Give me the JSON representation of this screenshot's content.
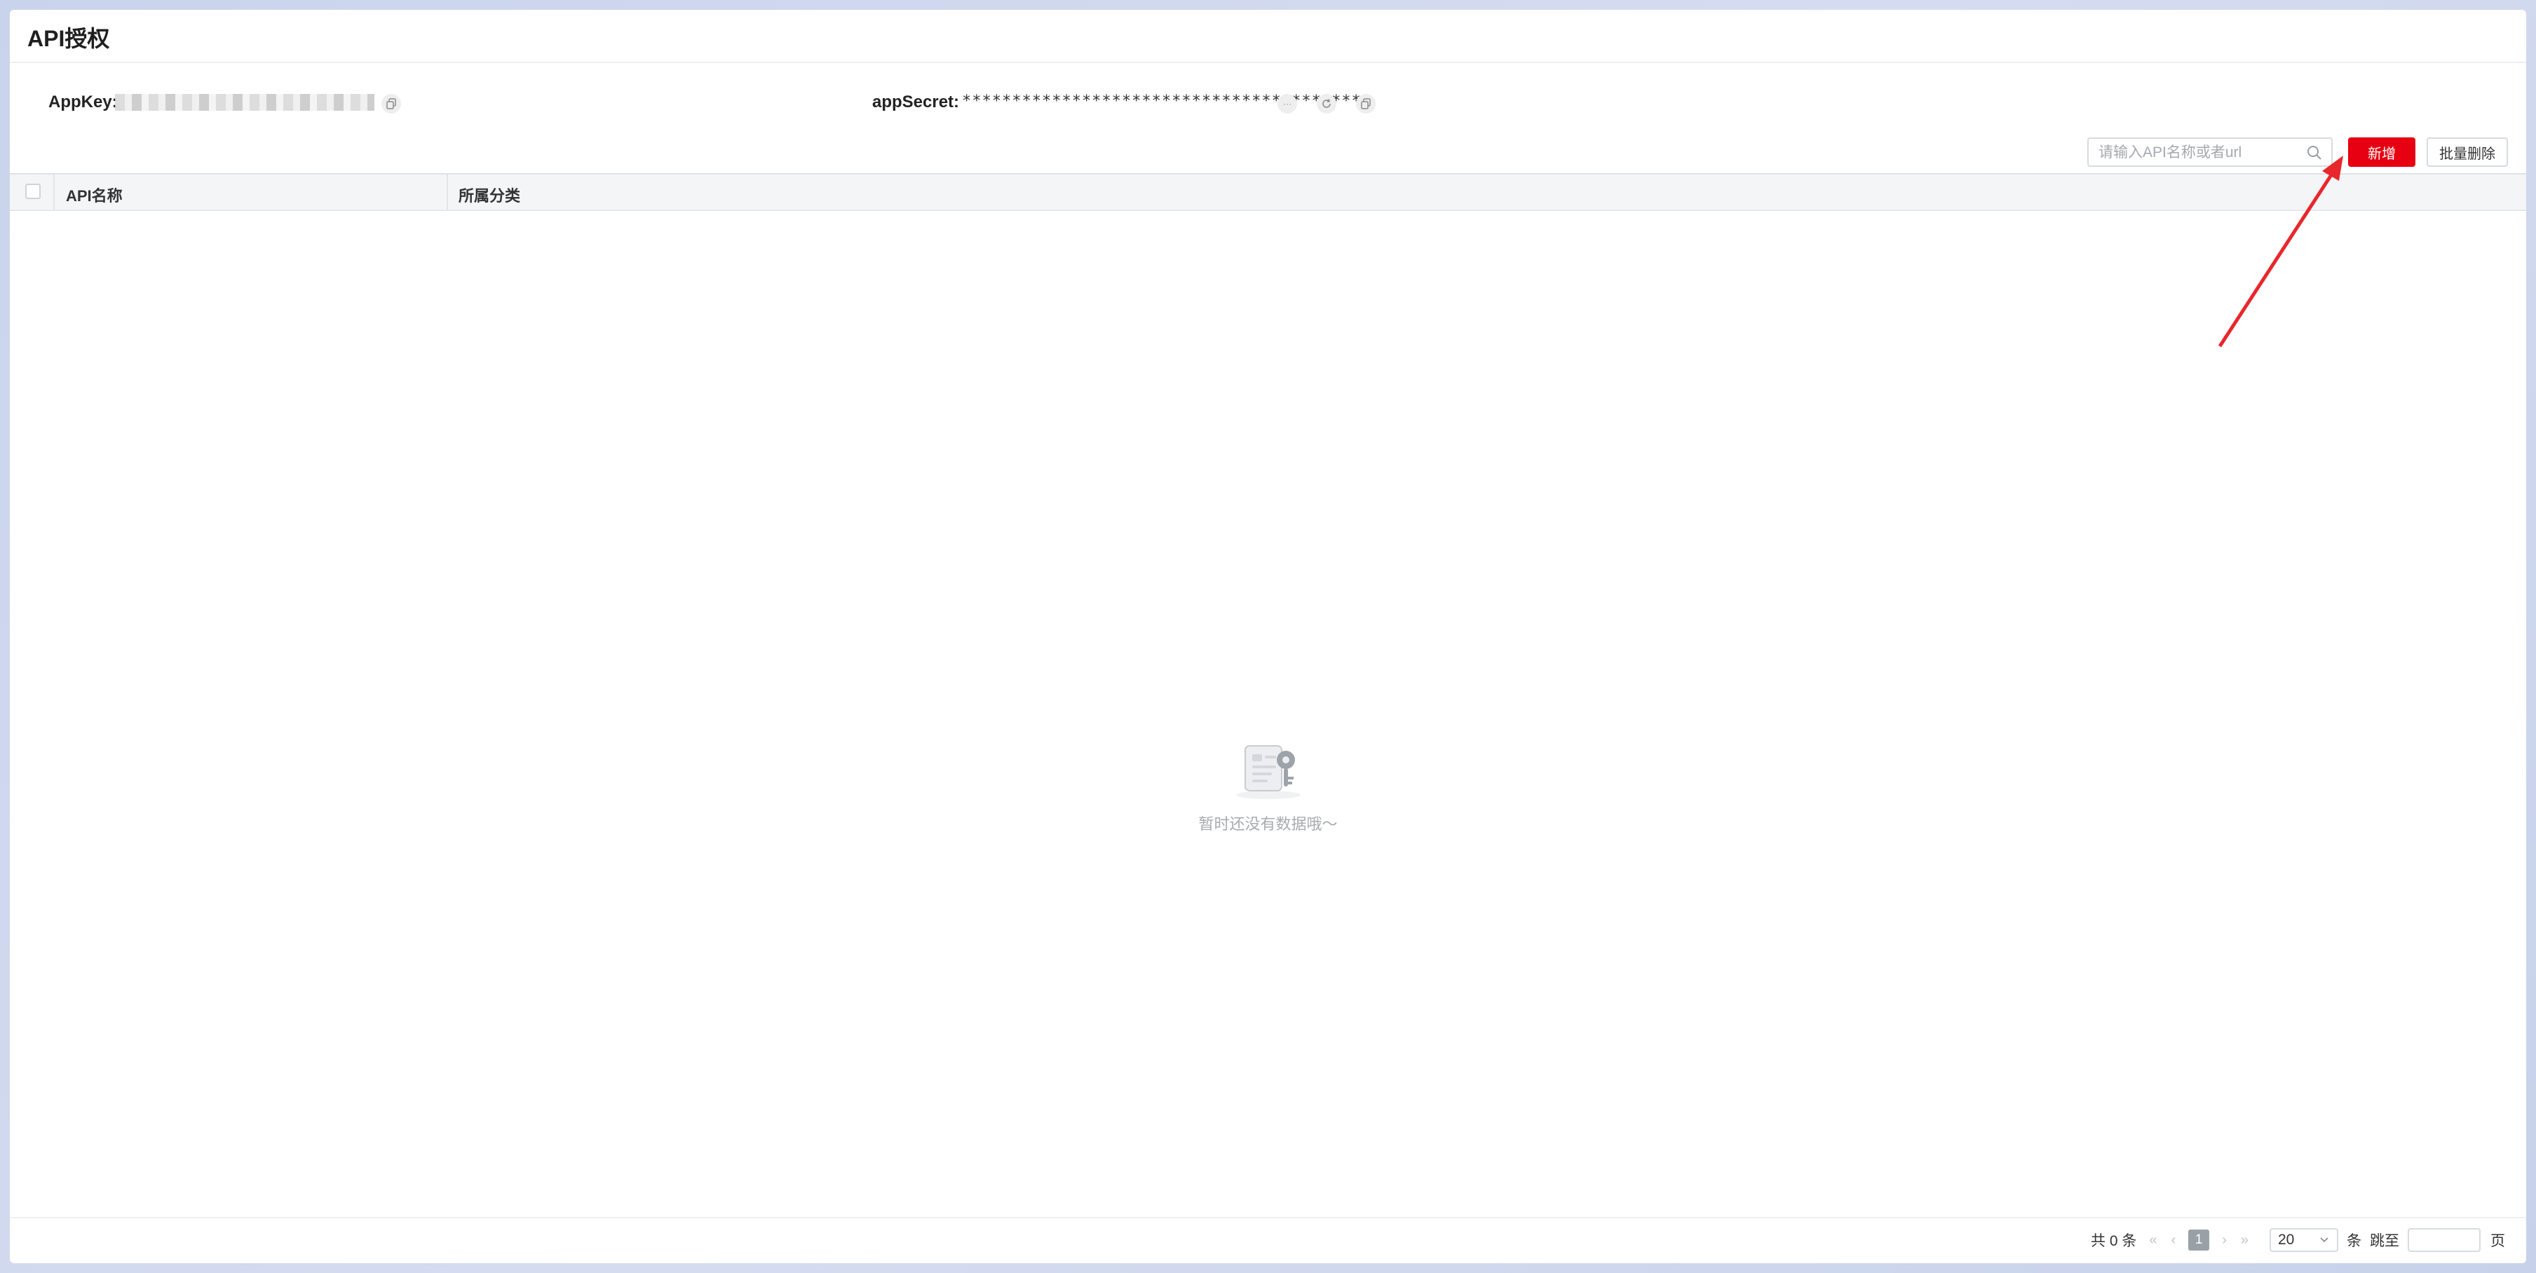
{
  "page": {
    "title": "API授权"
  },
  "credentials": {
    "app_key_label": "AppKey:",
    "app_secret_label": "appSecret:",
    "app_secret_value": "****************************************",
    "eye_icon_text": "···"
  },
  "toolbar": {
    "search_placeholder": "请输入API名称或者url",
    "add_label": "新增",
    "batch_delete_label": "批量删除"
  },
  "table": {
    "columns": [
      "API名称",
      "所属分类"
    ]
  },
  "empty_state": {
    "text": "暂时还没有数据哦～"
  },
  "pagination": {
    "total_label": "共 0 条",
    "first_icon": "«",
    "prev_icon": "‹",
    "current_page": "1",
    "next_icon": "›",
    "last_icon": "»",
    "page_size": "20",
    "page_size_unit": "条",
    "jump_label": "跳至",
    "page_unit": "页"
  },
  "colors": {
    "accent": "#e60012",
    "annotation_arrow": "#e8272c"
  }
}
